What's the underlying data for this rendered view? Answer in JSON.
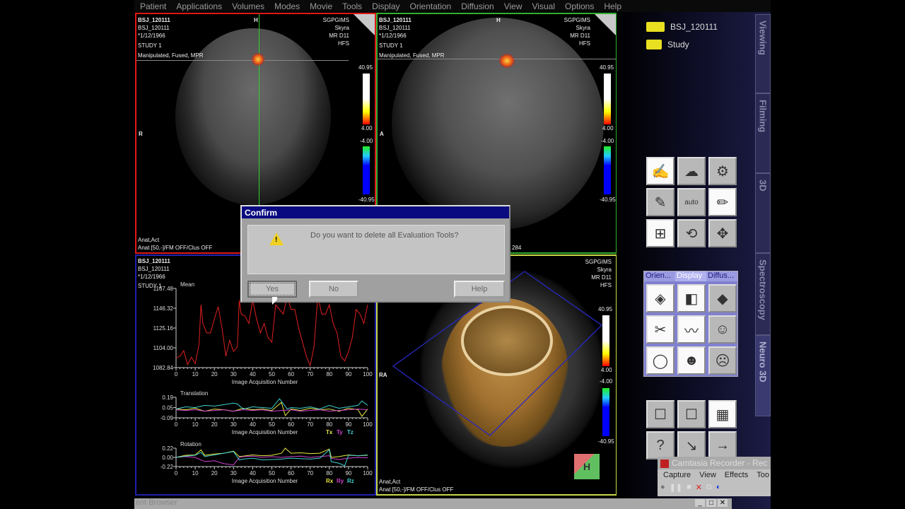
{
  "menu": [
    "Patient",
    "Applications",
    "Volumes",
    "Modes",
    "Movie",
    "Tools",
    "Display",
    "Orientation",
    "Diffusion",
    "View",
    "Visual",
    "Options",
    "Help"
  ],
  "patient": {
    "name": "BSJ_120111",
    "id": "BSJ_120111",
    "dob": "*1/12/1966",
    "study": "STUDY 1",
    "processing": "Manipulated, Fused, MPR",
    "institution": "SGPGIMS",
    "scanner": "Skyra",
    "series": "MR D11",
    "position": "HFS",
    "bottom1": "Anat,Act",
    "bottom2": "Anat [50,-]/FM OFF/Clus OFF",
    "partial": "284"
  },
  "colorbar": {
    "max": "40.95",
    "pos": "4.00",
    "neg": "-4.00",
    "min": "-40.95"
  },
  "orient": {
    "coronal_top": "H",
    "coronal_left": "R",
    "sagittal_top": "H",
    "sagittal_left": "A",
    "vr_left": "RA"
  },
  "viewport_colors": {
    "coronal": "#e01818",
    "sagittal": "#30b030",
    "charts": "#2020b0",
    "vr": "#c8d848"
  },
  "chart_data": [
    {
      "type": "line",
      "title": "Mean",
      "xlabel": "Image Acquisition Number",
      "xlim": [
        0,
        100
      ],
      "ylim": [
        1082.84,
        1167.48
      ],
      "yticks": [
        "1167.48",
        "1146.32",
        "1125.16",
        "1104.00",
        "1082.84"
      ],
      "xticks": [
        "0",
        "10",
        "20",
        "30",
        "40",
        "50",
        "60",
        "70",
        "80",
        "90",
        "100"
      ],
      "series": [
        {
          "name": "Mean",
          "color": "#e02020",
          "x": [
            0,
            2,
            4,
            6,
            8,
            10,
            12,
            13,
            14,
            16,
            18,
            20,
            22,
            24,
            26,
            28,
            30,
            32,
            33,
            34,
            36,
            38,
            40,
            42,
            44,
            46,
            48,
            50,
            52,
            54,
            56,
            58,
            60,
            62,
            64,
            66,
            68,
            70,
            72,
            74,
            76,
            78,
            80,
            82,
            84,
            86,
            88,
            90,
            92,
            94,
            96,
            98,
            100
          ],
          "y": [
            1093,
            1095,
            1101,
            1086,
            1094,
            1087,
            1108,
            1150,
            1130,
            1120,
            1120,
            1135,
            1148,
            1125,
            1095,
            1112,
            1100,
            1105,
            1155,
            1140,
            1138,
            1130,
            1155,
            1135,
            1120,
            1130,
            1115,
            1110,
            1150,
            1145,
            1140,
            1160,
            1145,
            1145,
            1125,
            1110,
            1095,
            1085,
            1105,
            1160,
            1140,
            1140,
            1150,
            1130,
            1120,
            1095,
            1090,
            1100,
            1115,
            1145,
            1140,
            1130,
            1150
          ]
        }
      ]
    },
    {
      "type": "line",
      "title": "Translation",
      "xlabel": "Image Acquisition Number",
      "xlim": [
        0,
        100
      ],
      "ylim": [
        -0.09,
        0.19
      ],
      "yticks": [
        "0.19",
        "0.05",
        "-0.09"
      ],
      "xticks": [
        "0",
        "10",
        "20",
        "30",
        "40",
        "50",
        "60",
        "70",
        "80",
        "90",
        "100"
      ],
      "series": [
        {
          "name": "Tx",
          "color": "#e8e840",
          "x": [
            0,
            5,
            10,
            15,
            20,
            25,
            30,
            35,
            40,
            45,
            50,
            55,
            57,
            60,
            65,
            70,
            75,
            80,
            85,
            90,
            95,
            97,
            100
          ],
          "y": [
            0.03,
            0.02,
            0.04,
            0.0,
            0.03,
            0.02,
            0.0,
            0.04,
            0.02,
            0.03,
            0.01,
            0.12,
            -0.06,
            0.03,
            0.01,
            0.04,
            0.02,
            0.03,
            0.0,
            0.04,
            0.02,
            -0.07,
            0.03
          ]
        },
        {
          "name": "Ty",
          "color": "#d040d0",
          "x": [
            0,
            5,
            10,
            15,
            20,
            25,
            30,
            35,
            40,
            45,
            50,
            55,
            60,
            65,
            70,
            75,
            80,
            85,
            90,
            95,
            100
          ],
          "y": [
            0.02,
            0.01,
            0.02,
            0.0,
            0.01,
            0.02,
            0.0,
            0.02,
            0.01,
            0.02,
            0.0,
            0.01,
            0.02,
            0.0,
            0.01,
            0.02,
            0.0,
            0.01,
            0.02,
            0.03,
            0.02
          ]
        },
        {
          "name": "Tz",
          "color": "#40d0d0",
          "x": [
            0,
            5,
            10,
            15,
            20,
            25,
            30,
            32,
            35,
            40,
            45,
            50,
            54,
            58,
            60,
            65,
            70,
            75,
            80,
            85,
            90,
            95,
            97,
            100
          ],
          "y": [
            0.03,
            0.06,
            0.05,
            0.08,
            0.07,
            0.09,
            0.11,
            0.1,
            0.03,
            0.06,
            0.05,
            0.04,
            0.17,
            0.03,
            0.05,
            0.04,
            0.06,
            0.03,
            0.08,
            0.04,
            0.06,
            0.08,
            0.14,
            0.08
          ]
        }
      ]
    },
    {
      "type": "line",
      "title": "Rotation",
      "xlabel": "Image Acquisition Number",
      "xlim": [
        0,
        100
      ],
      "ylim": [
        -0.22,
        0.22
      ],
      "yticks": [
        "0.22",
        "0.00",
        "-0.22"
      ],
      "xticks": [
        "0",
        "10",
        "20",
        "30",
        "40",
        "50",
        "60",
        "70",
        "80",
        "90",
        "100"
      ],
      "series": [
        {
          "name": "Rx",
          "color": "#e8e840",
          "x": [
            0,
            5,
            10,
            13,
            15,
            20,
            25,
            30,
            33,
            35,
            40,
            45,
            50,
            55,
            57,
            60,
            65,
            70,
            75,
            80,
            81,
            85,
            90,
            95,
            100
          ],
          "y": [
            0.0,
            0.05,
            0.06,
            0.18,
            0.05,
            0.08,
            0.1,
            0.15,
            0.02,
            0.03,
            0.06,
            0.04,
            0.05,
            0.1,
            0.22,
            0.1,
            0.11,
            0.09,
            0.1,
            0.2,
            0.0,
            0.02,
            0.06,
            0.04,
            0.05
          ]
        },
        {
          "name": "Ry",
          "color": "#d040d0",
          "x": [
            0,
            5,
            10,
            15,
            20,
            25,
            30,
            33,
            35,
            40,
            45,
            50,
            55,
            60,
            65,
            70,
            75,
            80,
            81,
            85,
            90,
            95,
            100
          ],
          "y": [
            0.0,
            0.02,
            0.0,
            -0.1,
            -0.08,
            -0.15,
            -0.18,
            0.0,
            0.02,
            0.03,
            0.0,
            0.02,
            0.0,
            0.02,
            0.03,
            0.0,
            0.02,
            0.04,
            -0.02,
            -0.05,
            -0.02,
            0.0,
            -0.01
          ]
        },
        {
          "name": "Rz",
          "color": "#40d0d0",
          "x": [
            0,
            5,
            10,
            13,
            15,
            20,
            25,
            30,
            33,
            35,
            40,
            45,
            50,
            55,
            60,
            65,
            70,
            75,
            80,
            81,
            85,
            88,
            90,
            95,
            100
          ],
          "y": [
            0.0,
            0.03,
            0.05,
            0.12,
            0.02,
            0.06,
            0.1,
            0.14,
            -0.06,
            -0.04,
            -0.02,
            -0.06,
            -0.05,
            -0.04,
            -0.02,
            -0.03,
            -0.04,
            -0.02,
            0.18,
            -0.1,
            -0.14,
            -0.2,
            0.05,
            0.04,
            0.06
          ]
        }
      ]
    }
  ],
  "right_panel": {
    "tree": [
      {
        "label": "BSJ_120111"
      },
      {
        "label": "Study"
      }
    ],
    "vtabs": [
      "Viewing",
      "Filming",
      "3D",
      "Spectroscopy",
      "Neuro 3D"
    ],
    "tool_icons": [
      "✍",
      "☁",
      "⚙",
      "✎",
      "auto",
      "✏",
      "⊞",
      "⟲",
      "✥"
    ],
    "subtabs": [
      "Orien...",
      "Display",
      "Diffus..."
    ],
    "display_icons": [
      "◈",
      "◧",
      "◆",
      "✂",
      "〰",
      "☺",
      "◯",
      "☻",
      "☹"
    ],
    "bottom_icons": [
      "☐",
      "☐",
      "▦",
      "?",
      "↘",
      "→"
    ]
  },
  "dialog": {
    "title": "Confirm",
    "message": "Do you want to delete all Evaluation Tools?",
    "yes": "Yes",
    "no": "No",
    "help": "Help"
  },
  "camtasia": {
    "title": "Camtasia Recorder - Rec",
    "menu": [
      "Capture",
      "View",
      "Effects",
      "Too"
    ]
  },
  "taskbar": {
    "label": "ent Browser"
  }
}
